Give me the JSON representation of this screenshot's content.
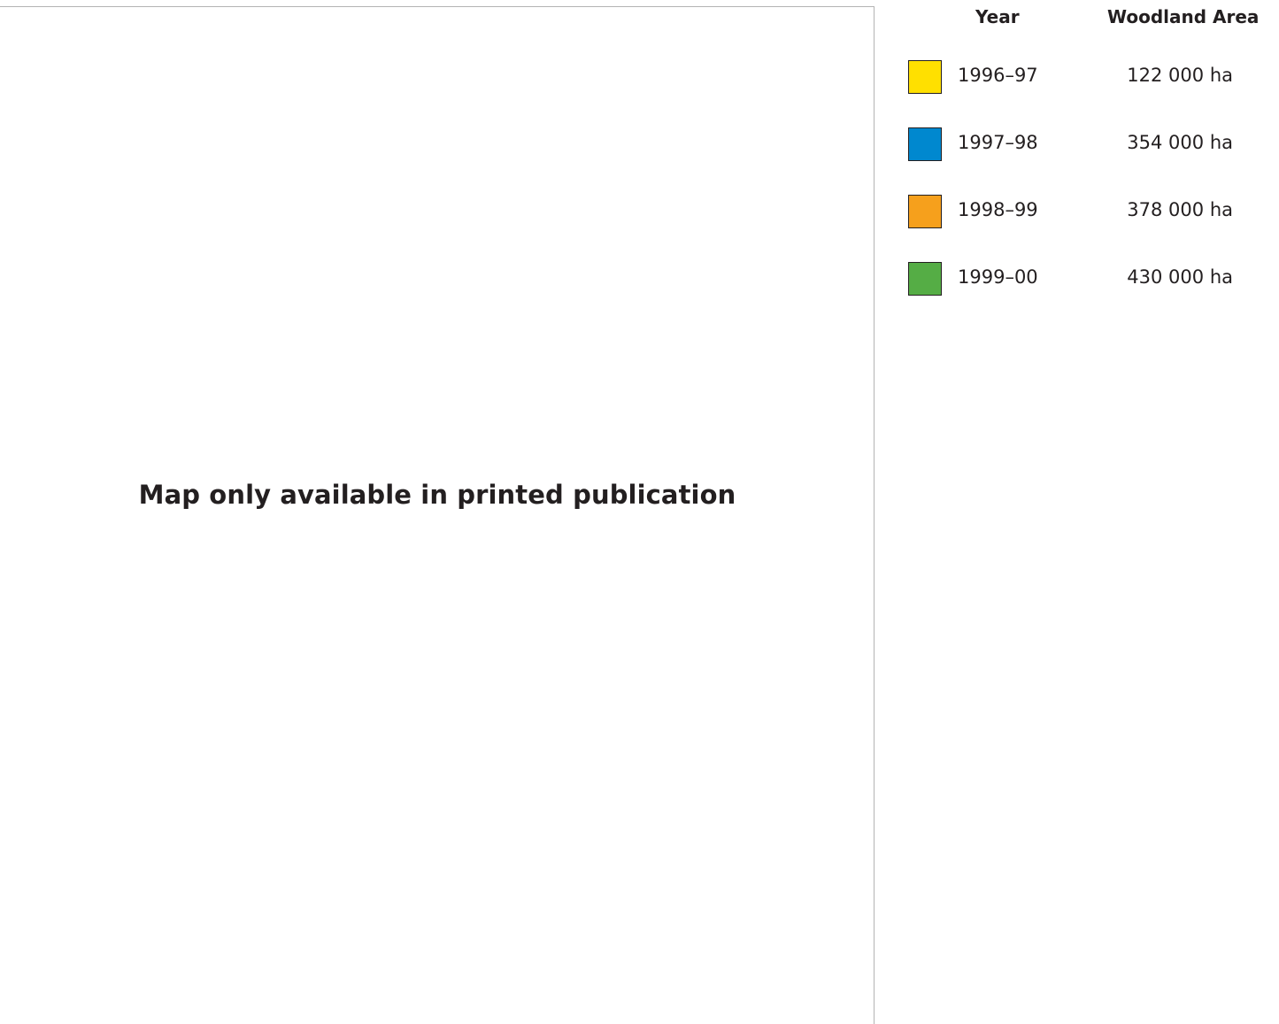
{
  "map": {
    "placeholder": "Map only available in printed publication"
  },
  "legend": {
    "header_year": "Year",
    "header_area": "Woodland Area",
    "rows": [
      {
        "year": "1996–97",
        "area": "122 000 ha",
        "color": "#ffe000"
      },
      {
        "year": "1997–98",
        "area": "354 000 ha",
        "color": "#0088cf"
      },
      {
        "year": "1998–99",
        "area": "378 000 ha",
        "color": "#f6a01c"
      },
      {
        "year": "1999–00",
        "area": "430 000 ha",
        "color": "#55ad45"
      }
    ]
  }
}
